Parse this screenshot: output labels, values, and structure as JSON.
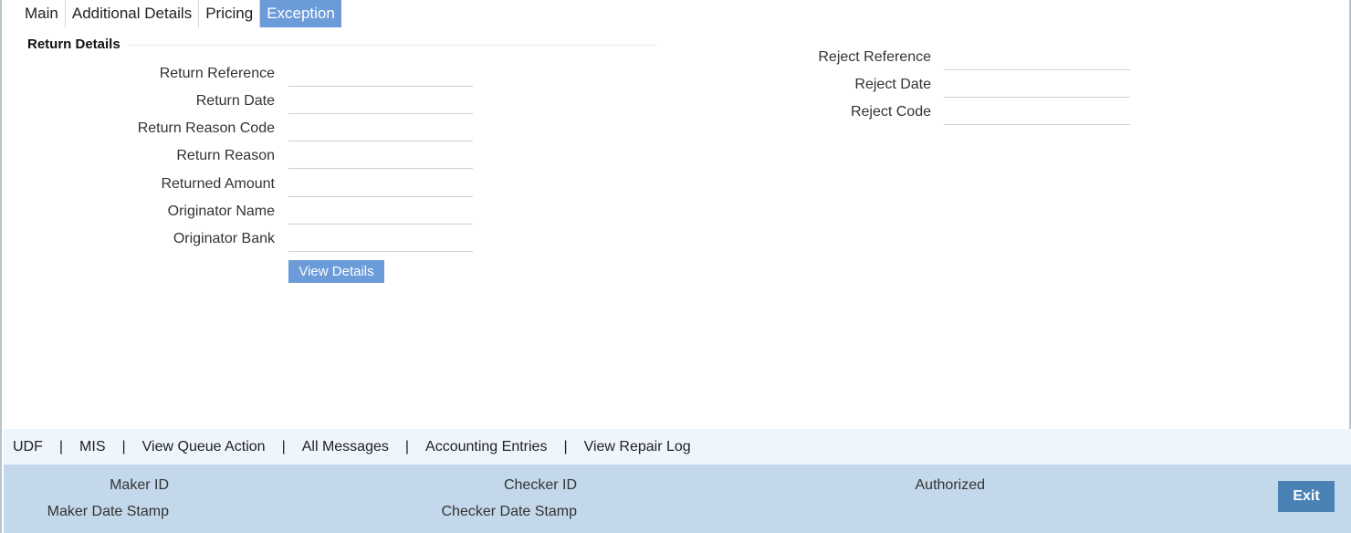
{
  "tabs": [
    {
      "label": "Main",
      "active": false
    },
    {
      "label": "Additional Details",
      "active": false
    },
    {
      "label": "Pricing",
      "active": false
    },
    {
      "label": "Exception",
      "active": true
    }
  ],
  "section": {
    "title": "Return Details"
  },
  "return_fields": {
    "return_reference": {
      "label": "Return Reference",
      "value": ""
    },
    "return_date": {
      "label": "Return Date",
      "value": ""
    },
    "return_reason_code": {
      "label": "Return Reason Code",
      "value": ""
    },
    "return_reason": {
      "label": "Return Reason",
      "value": ""
    },
    "returned_amount": {
      "label": "Returned Amount",
      "value": ""
    },
    "originator_name": {
      "label": "Originator Name",
      "value": ""
    },
    "originator_bank": {
      "label": "Originator Bank",
      "value": ""
    }
  },
  "view_details_label": "View Details",
  "reject_fields": {
    "reject_reference": {
      "label": "Reject Reference",
      "value": ""
    },
    "reject_date": {
      "label": "Reject Date",
      "value": ""
    },
    "reject_code": {
      "label": "Reject Code",
      "value": ""
    }
  },
  "action_links": {
    "udf": "UDF",
    "mis": "MIS",
    "view_queue_action": "View Queue Action",
    "all_messages": "All Messages",
    "accounting_entries": "Accounting Entries",
    "view_repair_log": "View Repair Log",
    "separator": "|"
  },
  "footer": {
    "maker_id": "Maker ID",
    "maker_date_stamp": "Maker Date Stamp",
    "checker_id": "Checker ID",
    "checker_date_stamp": "Checker Date Stamp",
    "authorized": "Authorized",
    "exit_label": "Exit"
  },
  "colors": {
    "tab_active_bg": "#6b9bd8",
    "button_bg": "#6b9bd8",
    "links_bar_bg": "#eef5fc",
    "footer_bg": "#c3d8ea",
    "exit_bg": "#4a82b6"
  }
}
